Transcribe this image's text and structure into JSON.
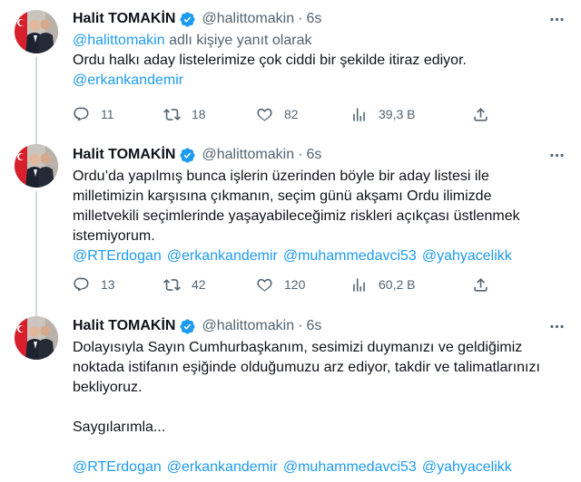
{
  "tweets": [
    {
      "name": "Halit TOMAKİN",
      "handle": "@halittomakin",
      "sep": "·",
      "time": "6s",
      "reply_mention": "@halittomakin",
      "reply_suffix": " adlı kişiye yanıt olarak",
      "text_lines": [
        "Ordu halkı aday listelerimize çok ciddi bir şekilde itiraz ediyor."
      ],
      "mentions": [
        "@erkankandemir"
      ],
      "replies": "11",
      "retweets": "18",
      "likes": "82",
      "views": "39,3 B"
    },
    {
      "name": "Halit TOMAKİN",
      "handle": "@halittomakin",
      "sep": "·",
      "time": "6s",
      "text_lines": [
        "Ordu’da yapılmış bunca işlerin üzerinden böyle bir aday listesi ile",
        "milletimizin karşısına çıkmanın, seçim günü akşamı Ordu ilimizde",
        "milletvekili seçimlerinde yaşayabileceğimiz riskleri açıkçası üstlenmek",
        "istemiyorum."
      ],
      "mentions": [
        "@RTErdogan",
        "@erkankandemir",
        "@muhammedavci53",
        "@yahyacelikk"
      ],
      "replies": "13",
      "retweets": "42",
      "likes": "120",
      "views": "60,2 B"
    },
    {
      "name": "Halit TOMAKİN",
      "handle": "@halittomakin",
      "sep": "·",
      "time": "6s",
      "text_lines": [
        "Dolayısıyla Sayın Cumhurbaşkanım, sesimizi duymanızı ve geldiğimiz",
        "noktada istifanın eşiğinde olduğumuzu arz ediyor, takdir ve talimatlarınızı",
        "bekliyoruz."
      ],
      "closing": "Saygılarımla...",
      "mentions": [
        "@RTErdogan",
        "@erkankandemir",
        "@muhammedavci53",
        "@yahyacelikk"
      ]
    }
  ],
  "icons": [
    "avatar",
    "verified-badge-icon",
    "more-icon",
    "reply-icon",
    "retweet-icon",
    "like-icon",
    "views-icon",
    "share-icon"
  ],
  "colors": {
    "link": "#1d9bf0",
    "muted": "#536471",
    "text": "#0f1419",
    "verified": "#1d9bf0",
    "thread": "#cfd9de"
  }
}
